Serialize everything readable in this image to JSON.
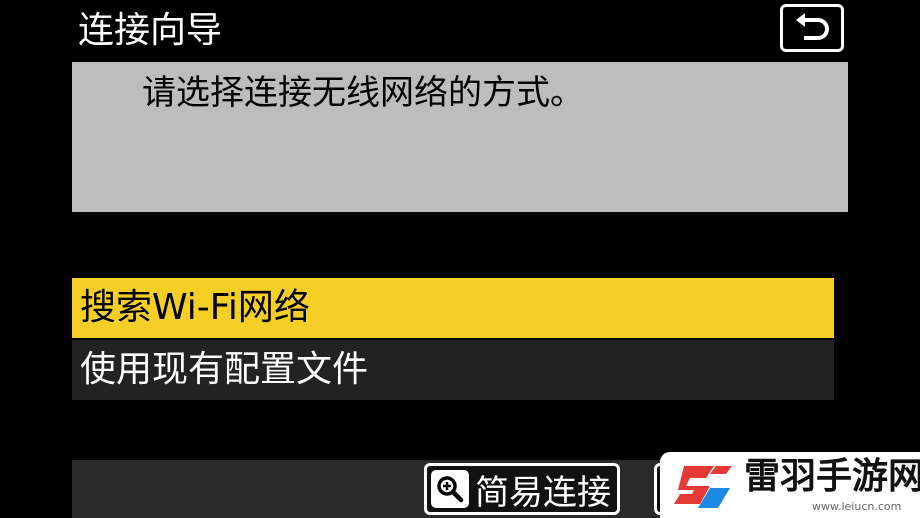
{
  "header": {
    "title": "连接向导",
    "back_icon": "return-arrow-icon"
  },
  "message": {
    "text": "请选择连接无线网络的方式。"
  },
  "menu": {
    "items": [
      {
        "label": "搜索Wi-Fi网络",
        "selected": true
      },
      {
        "label": "使用现有配置文件",
        "selected": false
      }
    ]
  },
  "footer": {
    "easy_connect_label": "简易连接",
    "easy_connect_icon": "zoom-in-icon"
  },
  "watermark": {
    "name": "雷羽手游网",
    "url": "www.leiucn.com"
  },
  "colors": {
    "background": "#000000",
    "message_bg": "#bdbdbd",
    "selected_bg": "#f5cf26",
    "unselected_bg": "#222222",
    "logo_red": "#e53935",
    "logo_blue": "#1e88e5"
  }
}
